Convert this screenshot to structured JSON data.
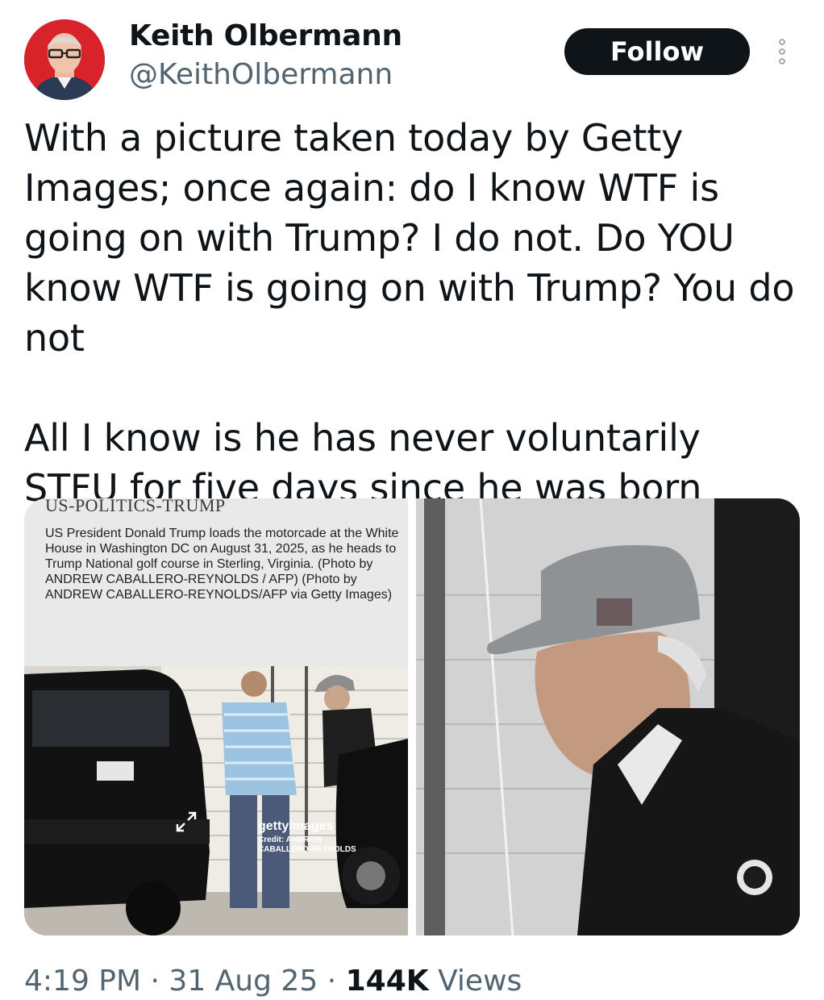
{
  "author": {
    "display_name": "Keith Olbermann",
    "handle": "@KeithOlbermann",
    "follow_label": "Follow"
  },
  "tweet": {
    "text": "With a picture taken today by Getty Images; once again: do I know WTF is going on with Trump? I do not. Do YOU know WTF is going on with Trump? You do not\n\nAll I know is he has never voluntarily STFU for five days since he was born"
  },
  "media": {
    "left_image": {
      "caption_title": "US-POLITICS-TRUMP",
      "caption_body": "US President Donald Trump loads the motorcade at the White House in Washington DC on August 31, 2025, as he heads to Trump National golf course in Sterling, Virginia. (Photo by ANDREW CABALLERO-REYNOLDS / AFP) (Photo by ANDREW CABALLERO-REYNOLDS/AFP via Getty Images)",
      "watermark_brand": "gettyimages",
      "watermark_credit": "Credit: ANDREW\nCABALLERO-REYNOLDS"
    }
  },
  "meta": {
    "time": "4:19 PM",
    "separator": "·",
    "date": "31 Aug 25",
    "views_count": "144K",
    "views_label": "Views"
  },
  "icons": [
    "profile-avatar",
    "more-options-icon",
    "expand-icon"
  ],
  "colors": {
    "text_primary": "#0f1419",
    "text_secondary": "#536471",
    "button_bg": "#0f1419",
    "avatar_bg": "#d8232a"
  }
}
